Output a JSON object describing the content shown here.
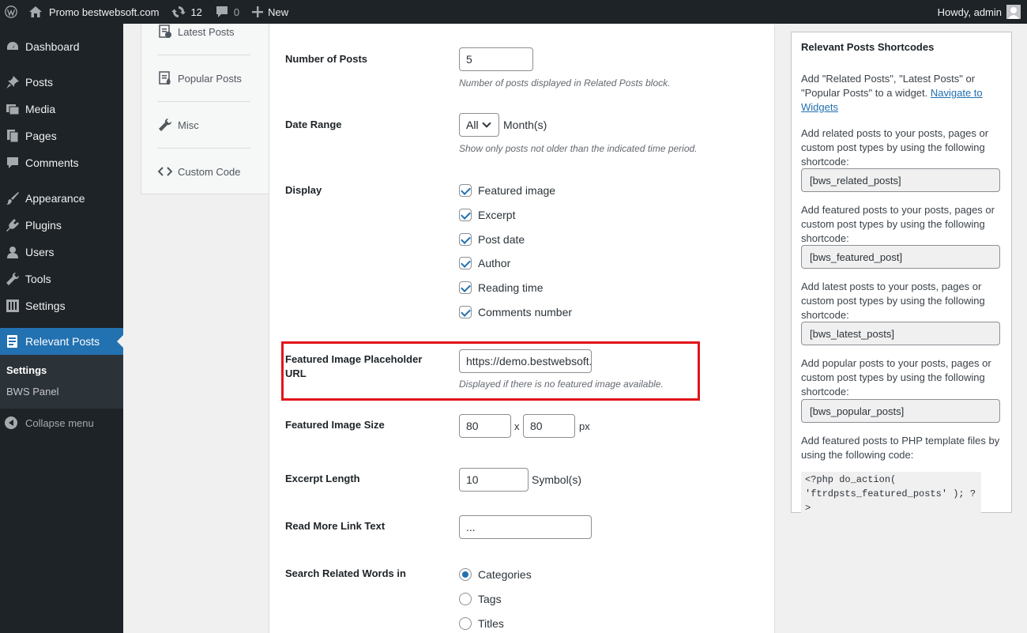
{
  "adminbar": {
    "site_name": "Promo bestwebsoft.com",
    "updates_count": "12",
    "comments_count": "0",
    "new_label": "New",
    "howdy": "Howdy, admin"
  },
  "sidebar": {
    "items": [
      {
        "label": "Dashboard",
        "icon": "dashboard-icon"
      },
      {
        "label": "Posts",
        "icon": "pin-icon"
      },
      {
        "label": "Media",
        "icon": "media-icon"
      },
      {
        "label": "Pages",
        "icon": "pages-icon"
      },
      {
        "label": "Comments",
        "icon": "comment-icon"
      },
      {
        "label": "Appearance",
        "icon": "brush-icon"
      },
      {
        "label": "Plugins",
        "icon": "plugin-icon"
      },
      {
        "label": "Users",
        "icon": "user-icon"
      },
      {
        "label": "Tools",
        "icon": "wrench-icon"
      },
      {
        "label": "Settings",
        "icon": "settings-icon"
      },
      {
        "label": "Relevant Posts",
        "icon": "relevant-posts-icon"
      }
    ],
    "submenu": [
      "Settings",
      "BWS Panel"
    ],
    "collapse": "Collapse menu"
  },
  "tabs": [
    {
      "label": "Latest Posts",
      "icon": "latest-posts-icon"
    },
    {
      "label": "Popular Posts",
      "icon": "popular-posts-icon"
    },
    {
      "label": "Misc",
      "icon": "wrench-icon"
    },
    {
      "label": "Custom Code",
      "icon": "code-icon"
    }
  ],
  "form": {
    "number_of_posts": {
      "label": "Number of Posts",
      "value": "5",
      "desc": "Number of posts displayed in Related Posts block."
    },
    "date_range": {
      "label": "Date Range",
      "value": "All",
      "suffix": "Month(s)",
      "desc": "Show only posts not older than the indicated time period."
    },
    "display": {
      "label": "Display",
      "options": [
        "Featured image",
        "Excerpt",
        "Post date",
        "Author",
        "Reading time",
        "Comments number"
      ]
    },
    "placeholder_url": {
      "label": "Featured Image Placeholder URL",
      "value": "https://demo.bestwebsoft.com",
      "desc": "Displayed if there is no featured image available."
    },
    "image_size": {
      "label": "Featured Image Size",
      "width": "80",
      "x": "x",
      "height": "80",
      "unit": "px"
    },
    "excerpt_length": {
      "label": "Excerpt Length",
      "value": "10",
      "suffix": "Symbol(s)"
    },
    "read_more": {
      "label": "Read More Link Text",
      "value": "..."
    },
    "search_in": {
      "label": "Search Related Words in",
      "options": [
        "Categories",
        "Tags",
        "Titles"
      ],
      "selected": "Categories"
    }
  },
  "widget": {
    "title": "Relevant Posts Shortcodes",
    "intro_text": "Add \"Related Posts\", \"Latest Posts\" or \"Popular Posts\" to a widget.",
    "intro_link": "Navigate to Widgets",
    "blocks": [
      {
        "text": "Add related posts to your posts, pages or custom post types by using the following shortcode:",
        "code": "[bws_related_posts]"
      },
      {
        "text": "Add featured posts to your posts, pages or custom post types by using the following shortcode:",
        "code": "[bws_featured_post]"
      },
      {
        "text": "Add latest posts to your posts, pages or custom post types by using the following shortcode:",
        "code": "[bws_latest_posts]"
      },
      {
        "text": "Add popular posts to your posts, pages or custom post types by using the following shortcode:",
        "code": "[bws_popular_posts]"
      }
    ],
    "php_text": "Add featured posts to PHP template files by using the following code:",
    "php_code": "<?php do_action( 'ftrdpsts_featured_posts' ); ?>"
  }
}
